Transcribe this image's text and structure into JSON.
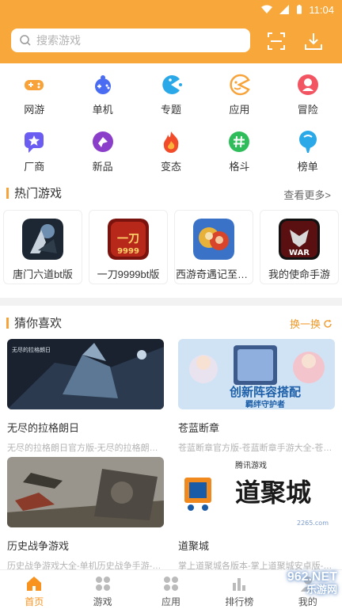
{
  "status": {
    "time": "11:04"
  },
  "search": {
    "placeholder": "搜索游戏"
  },
  "categories": [
    {
      "label": "网游",
      "icon": "gamepad-icon",
      "color": "#f7a33a"
    },
    {
      "label": "单机",
      "icon": "joystick-icon",
      "color": "#4a6cf2"
    },
    {
      "label": "专题",
      "icon": "pacman-icon",
      "color": "#2aa8e8"
    },
    {
      "label": "应用",
      "icon": "face-icon",
      "color": "#f7a33a"
    },
    {
      "label": "冒险",
      "icon": "adventure-icon",
      "color": "#f25561"
    },
    {
      "label": "厂商",
      "icon": "chat-star-icon",
      "color": "#6b5cf2"
    },
    {
      "label": "新品",
      "icon": "badge-icon",
      "color": "#8a3ec9"
    },
    {
      "label": "变态",
      "icon": "flame-icon",
      "color": "#f24b2a"
    },
    {
      "label": "格斗",
      "icon": "hash-icon",
      "color": "#2fbd5b"
    },
    {
      "label": "榜单",
      "icon": "balloon-icon",
      "color": "#2aa8e8"
    }
  ],
  "hot": {
    "title": "热门游戏",
    "more": "查看更多>",
    "items": [
      {
        "name": "唐门六道bt版",
        "thumb_color": "#243040"
      },
      {
        "name": "一刀9999bt版",
        "thumb_color": "#8a1b12"
      },
      {
        "name": "西游奇遇记至尊版",
        "thumb_color": "#c04020"
      },
      {
        "name": "我的使命手游",
        "thumb_color": "#2a2a2a"
      }
    ]
  },
  "guess": {
    "title": "猜你喜欢",
    "refresh": "换一换",
    "items": [
      {
        "title": "无尽的拉格朗日",
        "desc": "无尽的拉格朗日官方版-无尽的拉格朗日手游下载"
      },
      {
        "title": "苍蓝断章",
        "desc": "苍蓝断章官方版-苍蓝断章手游大全-苍蓝断章下载"
      },
      {
        "title": "历史战争游戏",
        "desc": "历史战争游戏大全-单机历史战争手游-历史战争游戏"
      },
      {
        "title": "道聚城",
        "desc": "掌上道聚城各版本-掌上道聚城安卓版-道聚城"
      }
    ],
    "banner_texts": {
      "lagrange_logo": "无尽的拉格朗日",
      "canglan_slogan1": "创新阵容搭配",
      "canglan_slogan2": "羁绊守护者",
      "daojucheng_brand": "腾讯游戏",
      "daojucheng_name": "道聚城",
      "daojucheng_site": "2265.com"
    }
  },
  "nav": [
    {
      "label": "首页",
      "active": true
    },
    {
      "label": "游戏",
      "active": false
    },
    {
      "label": "应用",
      "active": false
    },
    {
      "label": "排行榜",
      "active": false
    },
    {
      "label": "我的",
      "active": false
    }
  ],
  "watermark": {
    "line1": "962.NET",
    "line2": "乐游网"
  }
}
